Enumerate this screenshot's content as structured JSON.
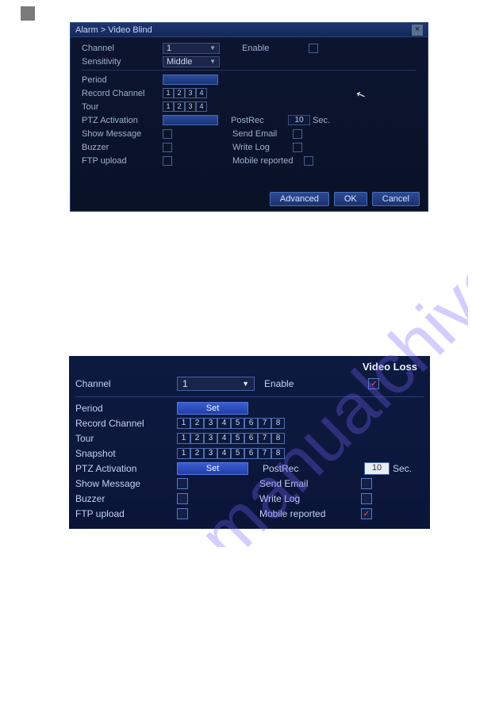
{
  "dialog1": {
    "title": "Alarm > Video Blind",
    "channel_label": "Channel",
    "channel_value": "1",
    "enable_label": "Enable",
    "sensitivity_label": "Sensitivity",
    "sensitivity_value": "Middle",
    "period_label": "Period",
    "record_channel_label": "Record Channel",
    "rc_nums": [
      "1",
      "2",
      "3",
      "4"
    ],
    "tour_label": "Tour",
    "tour_nums": [
      "1",
      "2",
      "3",
      "4"
    ],
    "ptz_label": "PTZ Activation",
    "postrec_label": "PostRec",
    "postrec_value": "10",
    "sec_label": "Sec.",
    "show_message_label": "Show Message",
    "send_email_label": "Send Email",
    "buzzer_label": "Buzzer",
    "write_log_label": "Write Log",
    "ftp_label": "FTP upload",
    "mobile_label": "Mobile reported",
    "btn_advanced": "Advanced",
    "btn_ok": "OK",
    "btn_cancel": "Cancel"
  },
  "panel2": {
    "title": "Video Loss",
    "channel_label": "Channel",
    "channel_value": "1",
    "enable_label": "Enable",
    "enable_checked": "✓",
    "period_label": "Period",
    "set_label": "Set",
    "record_channel_label": "Record Channel",
    "nums8": [
      "1",
      "2",
      "3",
      "4",
      "5",
      "6",
      "7",
      "8"
    ],
    "tour_label": "Tour",
    "snapshot_label": "Snapshot",
    "ptz_label": "PTZ Activation",
    "postrec_label": "PostRec",
    "postrec_value": "10",
    "sec_label": "Sec.",
    "show_message_label": "Show Message",
    "send_email_label": "Send Email",
    "buzzer_label": "Buzzer",
    "write_log_label": "Write Log",
    "ftp_label": "FTP upload",
    "mobile_label": "Mobile reported",
    "mobile_checked": "✓"
  },
  "watermark_text": "manualchive.com"
}
